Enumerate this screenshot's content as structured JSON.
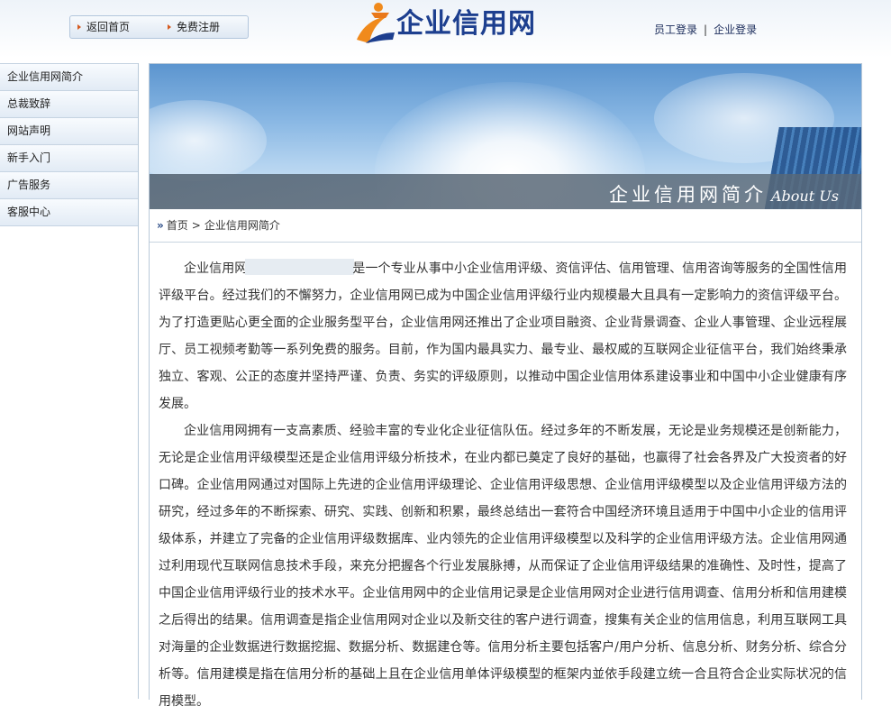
{
  "header": {
    "nav": [
      {
        "label": "返回首页"
      },
      {
        "label": "免费注册"
      }
    ],
    "logo_text": "企业信用网",
    "login": [
      "员工登录",
      "企业登录"
    ],
    "login_separator": "|"
  },
  "sidebar": {
    "items": [
      {
        "label": "企业信用网简介"
      },
      {
        "label": "总裁致辞"
      },
      {
        "label": "网站声明"
      },
      {
        "label": "新手入门"
      },
      {
        "label": "广告服务"
      },
      {
        "label": "客服中心"
      }
    ]
  },
  "banner": {
    "title_cn": "企业信用网简介",
    "title_en": "About Us"
  },
  "breadcrumb": {
    "marker": "»",
    "home": "首页",
    "separator": ">",
    "current": "企业信用网简介"
  },
  "content": {
    "p1_start": "企业信用网",
    "p1_rest": "是一个专业从事中小企业信用评级、资信评估、信用管理、信用咨询等服务的全国性信用评级平台。经过我们的不懈努力，企业信用网已成为中国企业信用评级行业内规模最大且具有一定影响力的资信评级平台。为了打造更贴心更全面的企业服务型平台，企业信用网还推出了企业项目融资、企业背景调查、企业人事管理、企业远程展厅、员工视频考勤等一系列免费的服务。目前，作为国内最具实力、最专业、最权威的互联网企业征信平台，我们始终秉承独立、客观、公正的态度并坚持严谨、负责、务实的评级原则，以推动中国企业信用体系建设事业和中国中小企业健康有序发展。",
    "p2": "企业信用网拥有一支高素质、经验丰富的专业化企业征信队伍。经过多年的不断发展，无论是业务规模还是创新能力，无论是企业信用评级模型还是企业信用评级分析技术，在业内都已奠定了良好的基础，也赢得了社会各界及广大投资者的好口碑。企业信用网通过对国际上先进的企业信用评级理论、企业信用评级思想、企业信用评级模型以及企业信用评级方法的研究，经过多年的不断探索、研究、实践、创新和积累，最终总结出一套符合中国经济环境且适用于中国中小企业的信用评级体系，并建立了完备的企业信用评级数据库、业内领先的企业信用评级模型以及科学的企业信用评级方法。企业信用网通过利用现代互联网信息技术手段，来充分把握各个行业发展脉搏，从而保证了企业信用评级结果的准确性、及时性，提高了中国企业信用评级行业的技术水平。企业信用网中的企业信用记录是企业信用网对企业进行信用调查、信用分析和信用建模之后得出的结果。信用调查是指企业信用网对企业以及新交往的客户进行调查，搜集有关企业的信用信息，利用互联网工具对海量的企业数据进行数据挖掘、数据分析、数据建仓等。信用分析主要包括客户/用户分析、信息分析、财务分析、综合分析等。信用建模是指在信用分析的基础上且在企业信用单体评级模型的框架内並依手段建立统一合且符合企业实际状况的信用模型。"
  },
  "colors": {
    "accent": "#1d3f8f",
    "arrow": "#d55a1f",
    "border": "#b9c9d9"
  }
}
